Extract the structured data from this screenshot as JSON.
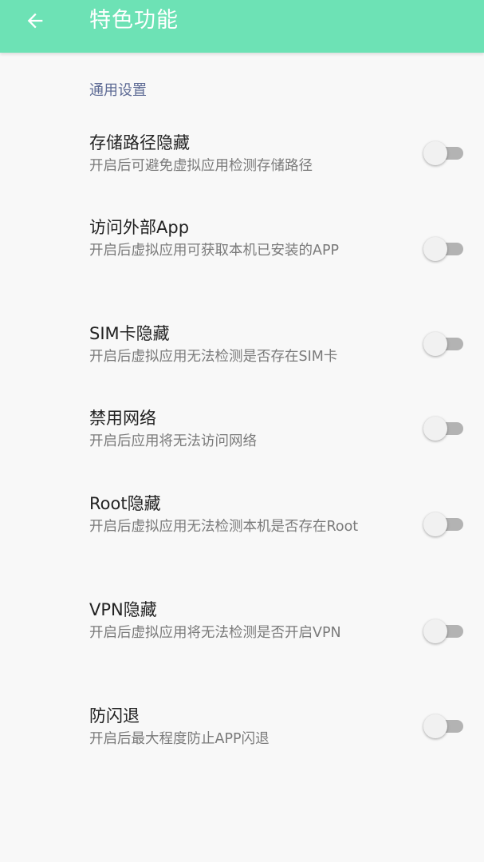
{
  "app_bar": {
    "title": "特色功能",
    "back_icon": "arrow-left-icon",
    "background": "#6de2b5"
  },
  "section": {
    "header": "通用设置"
  },
  "settings": [
    {
      "title": "存储路径隐藏",
      "summary": "开启后可避免虚拟应用检测存储路径",
      "enabled": false
    },
    {
      "title": "访问外部App",
      "summary": "开启后虚拟应用可获取本机已安装的APP",
      "enabled": false
    },
    {
      "title": "SIM卡隐藏",
      "summary": "开启后虚拟应用无法检测是否存在SIM卡",
      "enabled": false
    },
    {
      "title": "禁用网络",
      "summary": "开启后应用将无法访问网络",
      "enabled": false
    },
    {
      "title": "Root隐藏",
      "summary": "开启后虚拟应用无法检测本机是否存在Root",
      "enabled": false
    },
    {
      "title": "VPN隐藏",
      "summary": "开启后虚拟应用将无法检测是否开启VPN",
      "enabled": false
    },
    {
      "title": "防闪退",
      "summary": "开启后最大程度防止APP闪退",
      "enabled": false
    }
  ]
}
